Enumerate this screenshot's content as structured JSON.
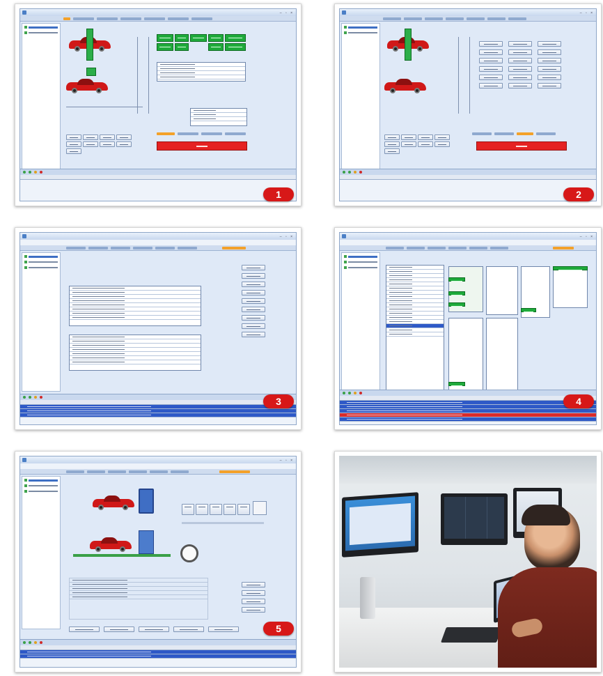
{
  "figure": {
    "panels": [
      {
        "badge": "1",
        "type": "screenshot",
        "view": "vehicle-position-with-alignment"
      },
      {
        "badge": "2",
        "type": "screenshot",
        "view": "vehicle-position-with-command-buttons"
      },
      {
        "badge": "3",
        "type": "screenshot",
        "view": "tabular-results"
      },
      {
        "badge": "4",
        "type": "screenshot",
        "view": "message-log-grid"
      },
      {
        "badge": "5",
        "type": "screenshot",
        "view": "vehicle-position-with-form"
      },
      {
        "badge": "",
        "type": "photo",
        "view": "operator-at-workstation"
      }
    ]
  },
  "colors": {
    "badge": "#d71818",
    "accent_tab": "#f3a12a",
    "status_green": "#1faa3b",
    "alert_red": "#e52222",
    "log_blue": "#2e59c7"
  },
  "icons": [
    "red-car-icon",
    "stopwatch-icon",
    "calendar-icon",
    "monitor-icon",
    "laptop-icon"
  ]
}
